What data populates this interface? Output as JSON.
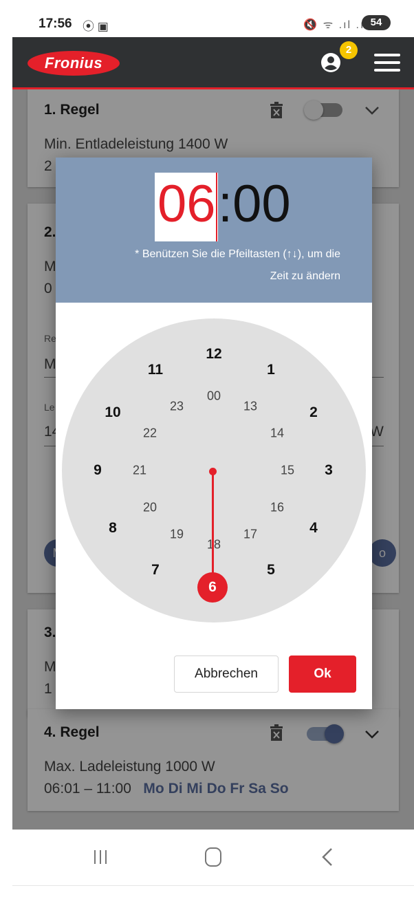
{
  "status_bar": {
    "time": "17:56",
    "left_icons": "⦿ ▣",
    "right_icons": "🔇 ᯤ .ıl .ıl",
    "battery": "54"
  },
  "app_bar": {
    "logo_text": "Fronius",
    "notification_count": "2",
    "accent_color": "#e4202a",
    "bar_color": "#2f3133"
  },
  "rules": [
    {
      "title": "1. Regel",
      "description": "Min. Entladeleistung   1400 W",
      "line2_partial": "2",
      "toggle_on": false
    },
    {
      "title": "2.",
      "lines_partial": [
        "M",
        "0"
      ],
      "field1_label_partial": "Re",
      "field1_value_partial": "M",
      "field2_label_partial": "Le",
      "field2_value_partial": "14",
      "field2_unit": "W",
      "chip_left_partial": "M",
      "chip_right_partial": "o"
    },
    {
      "title": "3.",
      "lines_partial": [
        "M",
        "1"
      ]
    },
    {
      "title": "4. Regel",
      "description": "Max. Ladeleistung   1000 W",
      "time_range": "06:01 – 11:00",
      "days": "Mo Di Mi Do Fr Sa So",
      "toggle_on": true
    }
  ],
  "time_picker": {
    "hour": "06",
    "minute": ":00",
    "hint_line1": "* Benützen Sie die Pfeiltasten (↑↓), um die",
    "hint_line2": "Zeit zu ändern",
    "selected_hour": "6",
    "outer_hours": [
      "12",
      "1",
      "2",
      "3",
      "4",
      "5",
      "7",
      "8",
      "9",
      "10",
      "11"
    ],
    "inner_hours": [
      "00",
      "13",
      "14",
      "15",
      "16",
      "17",
      "18",
      "19",
      "20",
      "21",
      "22",
      "23"
    ],
    "cancel_label": "Abbrechen",
    "ok_label": "Ok"
  },
  "icons": {
    "user": "account-circle-icon",
    "menu": "hamburger-menu-icon",
    "trash": "delete-icon",
    "chevron": "chevron-down-icon",
    "nav_recent": "recent-apps-icon",
    "nav_home": "home-icon",
    "nav_back": "back-icon"
  }
}
